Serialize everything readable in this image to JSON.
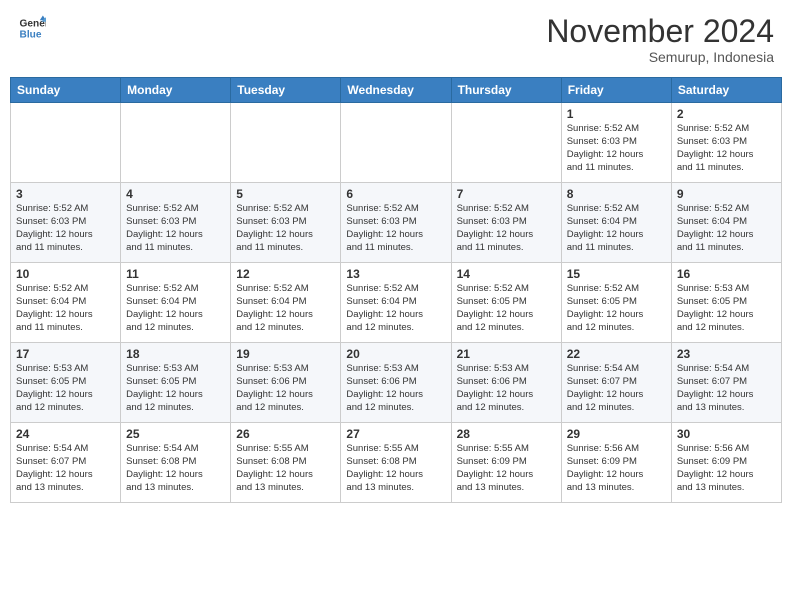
{
  "header": {
    "logo_line1": "General",
    "logo_line2": "Blue",
    "month": "November 2024",
    "location": "Semurup, Indonesia"
  },
  "weekdays": [
    "Sunday",
    "Monday",
    "Tuesday",
    "Wednesday",
    "Thursday",
    "Friday",
    "Saturday"
  ],
  "weeks": [
    [
      {
        "day": "",
        "info": ""
      },
      {
        "day": "",
        "info": ""
      },
      {
        "day": "",
        "info": ""
      },
      {
        "day": "",
        "info": ""
      },
      {
        "day": "",
        "info": ""
      },
      {
        "day": "1",
        "info": "Sunrise: 5:52 AM\nSunset: 6:03 PM\nDaylight: 12 hours\nand 11 minutes."
      },
      {
        "day": "2",
        "info": "Sunrise: 5:52 AM\nSunset: 6:03 PM\nDaylight: 12 hours\nand 11 minutes."
      }
    ],
    [
      {
        "day": "3",
        "info": "Sunrise: 5:52 AM\nSunset: 6:03 PM\nDaylight: 12 hours\nand 11 minutes."
      },
      {
        "day": "4",
        "info": "Sunrise: 5:52 AM\nSunset: 6:03 PM\nDaylight: 12 hours\nand 11 minutes."
      },
      {
        "day": "5",
        "info": "Sunrise: 5:52 AM\nSunset: 6:03 PM\nDaylight: 12 hours\nand 11 minutes."
      },
      {
        "day": "6",
        "info": "Sunrise: 5:52 AM\nSunset: 6:03 PM\nDaylight: 12 hours\nand 11 minutes."
      },
      {
        "day": "7",
        "info": "Sunrise: 5:52 AM\nSunset: 6:03 PM\nDaylight: 12 hours\nand 11 minutes."
      },
      {
        "day": "8",
        "info": "Sunrise: 5:52 AM\nSunset: 6:04 PM\nDaylight: 12 hours\nand 11 minutes."
      },
      {
        "day": "9",
        "info": "Sunrise: 5:52 AM\nSunset: 6:04 PM\nDaylight: 12 hours\nand 11 minutes."
      }
    ],
    [
      {
        "day": "10",
        "info": "Sunrise: 5:52 AM\nSunset: 6:04 PM\nDaylight: 12 hours\nand 11 minutes."
      },
      {
        "day": "11",
        "info": "Sunrise: 5:52 AM\nSunset: 6:04 PM\nDaylight: 12 hours\nand 12 minutes."
      },
      {
        "day": "12",
        "info": "Sunrise: 5:52 AM\nSunset: 6:04 PM\nDaylight: 12 hours\nand 12 minutes."
      },
      {
        "day": "13",
        "info": "Sunrise: 5:52 AM\nSunset: 6:04 PM\nDaylight: 12 hours\nand 12 minutes."
      },
      {
        "day": "14",
        "info": "Sunrise: 5:52 AM\nSunset: 6:05 PM\nDaylight: 12 hours\nand 12 minutes."
      },
      {
        "day": "15",
        "info": "Sunrise: 5:52 AM\nSunset: 6:05 PM\nDaylight: 12 hours\nand 12 minutes."
      },
      {
        "day": "16",
        "info": "Sunrise: 5:53 AM\nSunset: 6:05 PM\nDaylight: 12 hours\nand 12 minutes."
      }
    ],
    [
      {
        "day": "17",
        "info": "Sunrise: 5:53 AM\nSunset: 6:05 PM\nDaylight: 12 hours\nand 12 minutes."
      },
      {
        "day": "18",
        "info": "Sunrise: 5:53 AM\nSunset: 6:05 PM\nDaylight: 12 hours\nand 12 minutes."
      },
      {
        "day": "19",
        "info": "Sunrise: 5:53 AM\nSunset: 6:06 PM\nDaylight: 12 hours\nand 12 minutes."
      },
      {
        "day": "20",
        "info": "Sunrise: 5:53 AM\nSunset: 6:06 PM\nDaylight: 12 hours\nand 12 minutes."
      },
      {
        "day": "21",
        "info": "Sunrise: 5:53 AM\nSunset: 6:06 PM\nDaylight: 12 hours\nand 12 minutes."
      },
      {
        "day": "22",
        "info": "Sunrise: 5:54 AM\nSunset: 6:07 PM\nDaylight: 12 hours\nand 12 minutes."
      },
      {
        "day": "23",
        "info": "Sunrise: 5:54 AM\nSunset: 6:07 PM\nDaylight: 12 hours\nand 13 minutes."
      }
    ],
    [
      {
        "day": "24",
        "info": "Sunrise: 5:54 AM\nSunset: 6:07 PM\nDaylight: 12 hours\nand 13 minutes."
      },
      {
        "day": "25",
        "info": "Sunrise: 5:54 AM\nSunset: 6:08 PM\nDaylight: 12 hours\nand 13 minutes."
      },
      {
        "day": "26",
        "info": "Sunrise: 5:55 AM\nSunset: 6:08 PM\nDaylight: 12 hours\nand 13 minutes."
      },
      {
        "day": "27",
        "info": "Sunrise: 5:55 AM\nSunset: 6:08 PM\nDaylight: 12 hours\nand 13 minutes."
      },
      {
        "day": "28",
        "info": "Sunrise: 5:55 AM\nSunset: 6:09 PM\nDaylight: 12 hours\nand 13 minutes."
      },
      {
        "day": "29",
        "info": "Sunrise: 5:56 AM\nSunset: 6:09 PM\nDaylight: 12 hours\nand 13 minutes."
      },
      {
        "day": "30",
        "info": "Sunrise: 5:56 AM\nSunset: 6:09 PM\nDaylight: 12 hours\nand 13 minutes."
      }
    ]
  ]
}
